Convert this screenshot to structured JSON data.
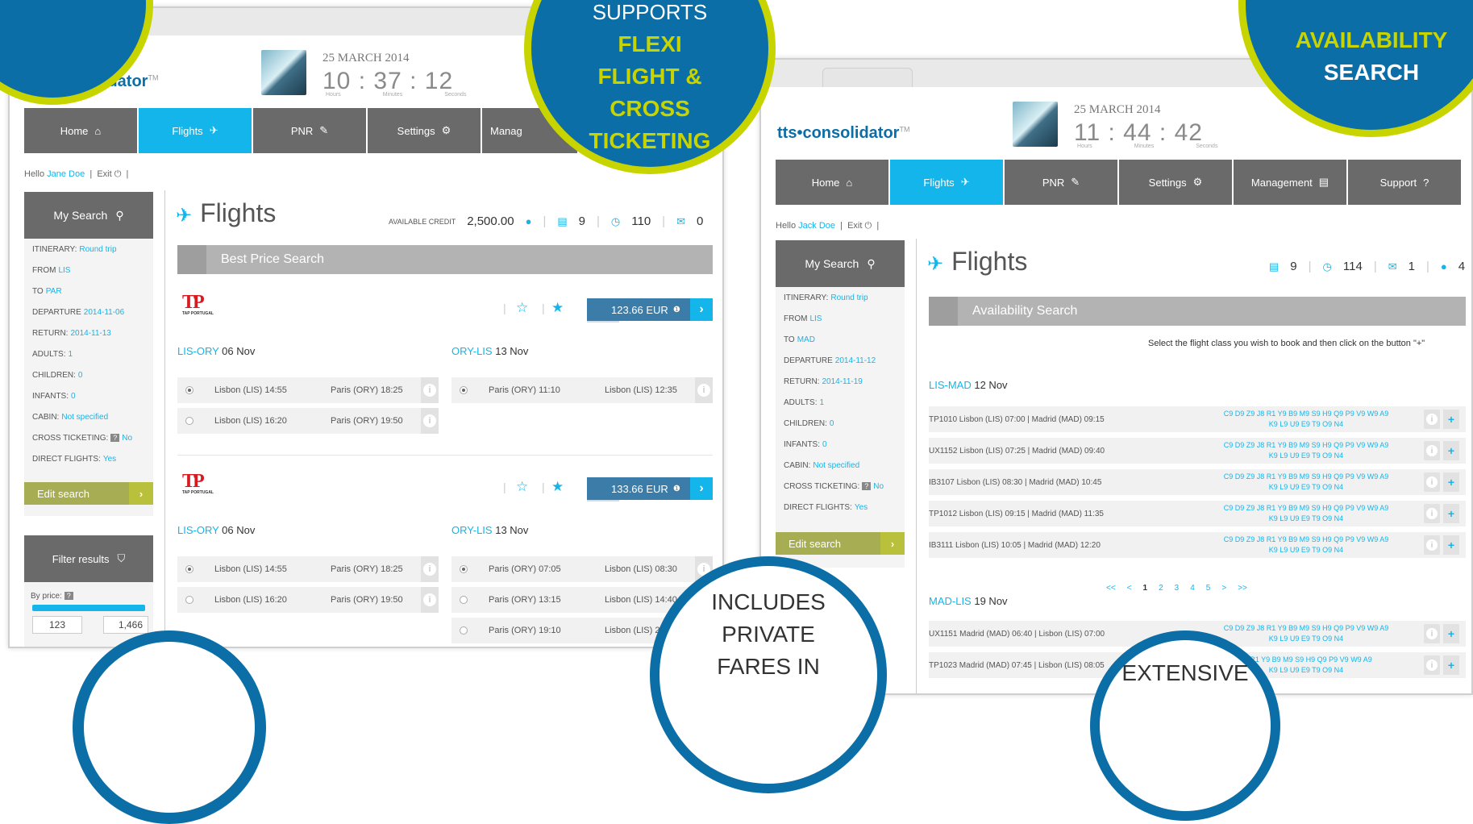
{
  "left": {
    "logo": "tts•consolidator",
    "tm": "TM",
    "date": "25 MARCH 2014",
    "time": {
      "h": "10",
      "m": "37",
      "s": "12",
      "hl": "Hours",
      "ml": "Minutes",
      "sl": "Seconds"
    },
    "nav": [
      "Home",
      "Flights",
      "PNR",
      "Settings",
      "Manag"
    ],
    "hello": "Hello",
    "user": "Jane Doe",
    "exit": "Exit",
    "my_search": "My Search",
    "search_rows": [
      {
        "k": "ITINERARY:",
        "v": "Round trip"
      },
      {
        "k": "FROM",
        "v": "LIS"
      },
      {
        "k": "TO",
        "v": "PAR"
      },
      {
        "k": "DEPARTURE",
        "v": "2014-11-06"
      },
      {
        "k": "RETURN:",
        "v": "2014-11-13"
      },
      {
        "k": "ADULTS:",
        "v": "1"
      },
      {
        "k": "CHILDREN:",
        "v": "0"
      },
      {
        "k": "INFANTS:",
        "v": "0"
      },
      {
        "k": "CABIN:",
        "v": "Not specified"
      },
      {
        "k": "CROSS TICKETING:",
        "v": "No"
      },
      {
        "k": "DIRECT FLIGHTS:",
        "v": "Yes"
      }
    ],
    "edit_search": "Edit search",
    "filter_results": "Filter results",
    "by_price": "By price:",
    "price_min": "123",
    "price_max": "1,466",
    "title": "Flights",
    "avail_credit": "AVAILABLE CREDIT",
    "credit": "2,500.00",
    "stat1": "9",
    "stat2": "110",
    "stat3": "0",
    "bar": "Best Price Search",
    "tap_small": "TAP PORTUGAL",
    "offers": [
      {
        "price": "123.66 EUR",
        "out_route": "LIS-ORY",
        "out_date": "06 Nov",
        "in_route": "ORY-LIS",
        "in_date": "13 Nov",
        "out": [
          {
            "dep": "Lisbon (LIS) 14:55",
            "arr": "Paris (ORY) 18:25"
          },
          {
            "dep": "Lisbon (LIS) 16:20",
            "arr": "Paris (ORY) 19:50"
          }
        ],
        "in": [
          {
            "dep": "Paris (ORY) 11:10",
            "arr": "Lisbon (LIS) 12:35"
          }
        ]
      },
      {
        "price": "133.66 EUR",
        "out_route": "LIS-ORY",
        "out_date": "06 Nov",
        "in_route": "ORY-LIS",
        "in_date": "13 Nov",
        "out": [
          {
            "dep": "Lisbon (LIS) 14:55",
            "arr": "Paris (ORY) 18:25"
          },
          {
            "dep": "Lisbon (LIS) 16:20",
            "arr": "Paris (ORY) 19:50"
          }
        ],
        "in": [
          {
            "dep": "Paris (ORY) 07:05",
            "arr": "Lisbon (LIS) 08:30"
          },
          {
            "dep": "Paris (ORY) 13:15",
            "arr": "Lisbon (LIS) 14:40"
          },
          {
            "dep": "Paris (ORY) 19:10",
            "arr": "Lisbon (LIS) 20:"
          }
        ]
      }
    ]
  },
  "right": {
    "logo": "tts•consolidator",
    "tm": "TM",
    "date": "25 MARCH 2014",
    "time": {
      "h": "11",
      "m": "44",
      "s": "42",
      "hl": "Hours",
      "ml": "Minutes",
      "sl": "Seconds"
    },
    "nav": [
      "Home",
      "Flights",
      "PNR",
      "Settings",
      "Management",
      "Support"
    ],
    "hello": "Hello",
    "user": "Jack Doe",
    "exit": "Exit",
    "my_search": "My Search",
    "search_rows": [
      {
        "k": "ITINERARY:",
        "v": "Round trip"
      },
      {
        "k": "FROM",
        "v": "LIS"
      },
      {
        "k": "TO",
        "v": "MAD"
      },
      {
        "k": "DEPARTURE",
        "v": "2014-11-12"
      },
      {
        "k": "RETURN:",
        "v": "2014-11-19"
      },
      {
        "k": "ADULTS:",
        "v": "1"
      },
      {
        "k": "CHILDREN:",
        "v": "0"
      },
      {
        "k": "INFANTS:",
        "v": "0"
      },
      {
        "k": "CABIN:",
        "v": "Not specified"
      },
      {
        "k": "CROSS TICKETING:",
        "v": "No"
      },
      {
        "k": "DIRECT FLIGHTS:",
        "v": "Yes"
      }
    ],
    "edit_search": "Edit search",
    "title": "Flights",
    "stat1": "9",
    "stat2": "114",
    "stat3": "1",
    "stat4": "4",
    "bar": "Availability Search",
    "instruction": "Select the flight class you wish to book and then click on the button \"+\"",
    "out_route": "LIS-MAD",
    "out_date": "12 Nov",
    "in_route": "MAD-LIS",
    "in_date": "19 Nov",
    "classes": "C9 D9 Z9 J8 R1 Y9 B9 M9 S9 H9 Q9 P9 V9 W9 A9",
    "classes2": "K9 L9 U9 E9 T9 O9 N4",
    "classes_partial": "J8 R1 Y9 B9 M9 S9 H9 Q9 P9 V9 W9 A9",
    "classes_partial3": "Y9 B9 M9 S9 H9 Q9 P9 V9 W9 A9",
    "out_flights": [
      "TP1010 Lisbon (LIS) 07:00 | Madrid (MAD) 09:15",
      "UX1152 Lisbon (LIS) 07:25 | Madrid (MAD) 09:40",
      "IB3107 Lisbon (LIS) 08:30 | Madrid (MAD) 10:45",
      "TP1012 Lisbon (LIS) 09:15 | Madrid (MAD) 11:35",
      "IB3111 Lisbon (LIS) 10:05 | Madrid (MAD) 12:20"
    ],
    "in_flights": [
      "UX1151 Madrid (MAD) 06:40 | Lisbon (LIS) 07:00",
      "TP1023 Madrid (MAD) 07:45 | Lisbon (LIS) 08:05"
    ],
    "pager": [
      "<<",
      "<",
      "1",
      "2",
      "3",
      "4",
      "5",
      ">",
      ">>"
    ]
  },
  "callouts": {
    "flexi": [
      "SUPPORTS",
      "FLEXI",
      "FLIGHT &",
      "CROSS",
      "TICKETING"
    ],
    "avail": [
      "AVAILABILITY",
      "SEARCH"
    ],
    "private": [
      "INCLUDES",
      "PRIVATE",
      "FARES IN"
    ],
    "extensive": "EXTENSIVE"
  },
  "colors": {
    "accent": "#13b5ea",
    "brand": "#0b6ea6",
    "lime": "#c8d400",
    "nav": "#6a6a6a"
  }
}
